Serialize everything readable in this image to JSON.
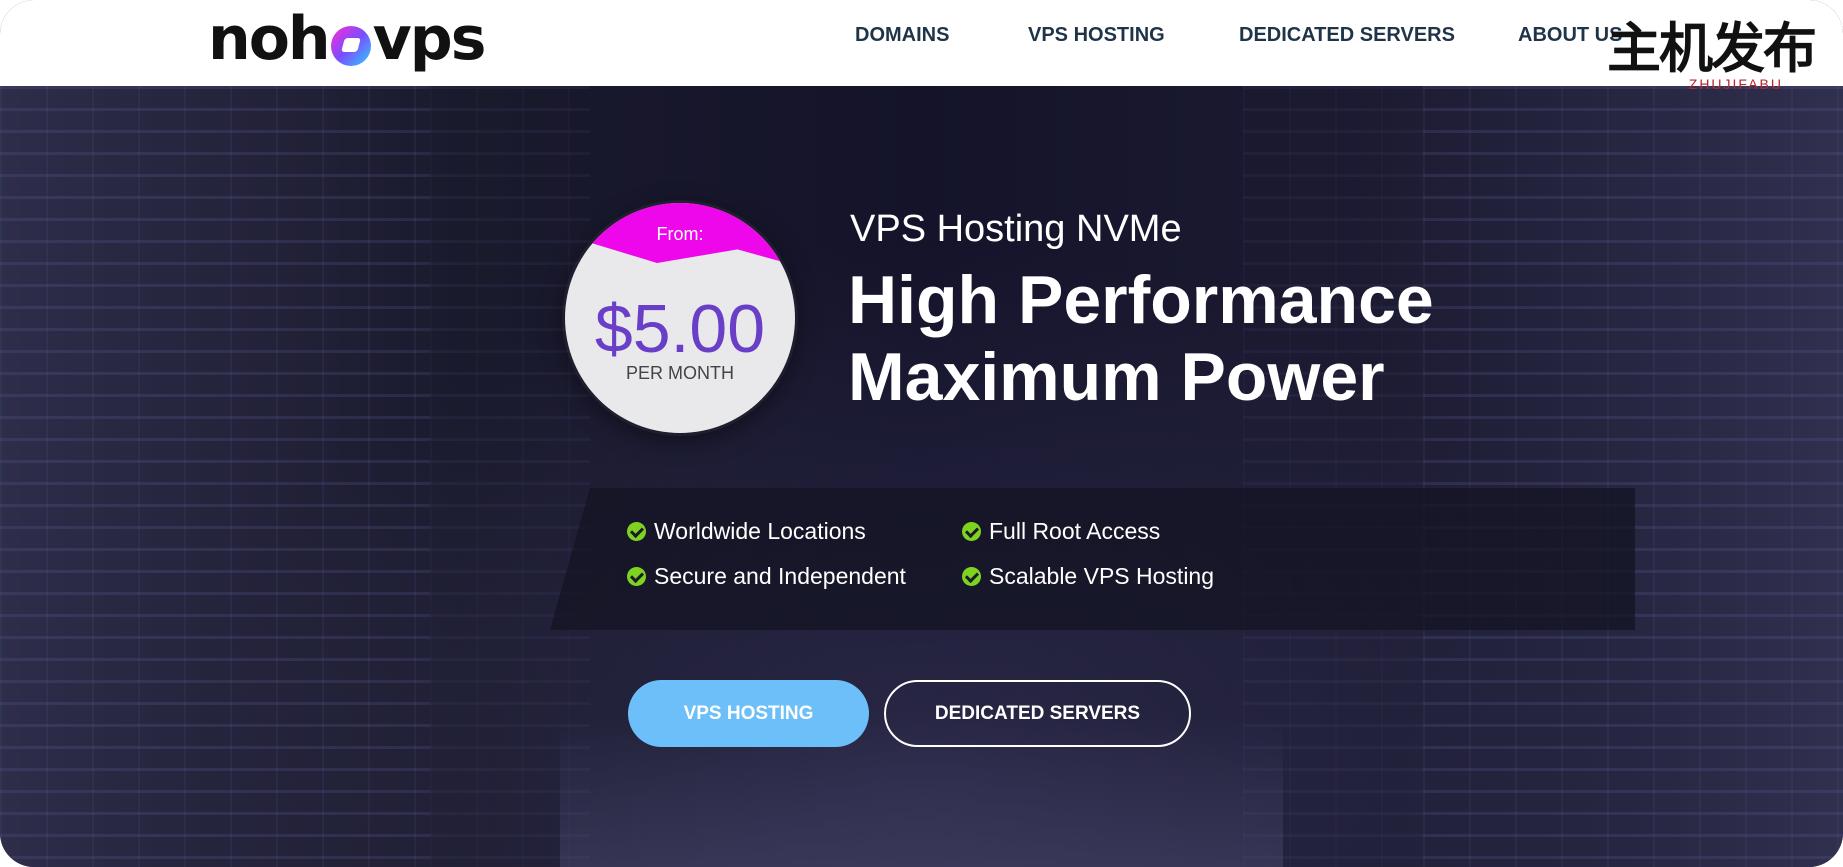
{
  "header": {
    "logo": {
      "left": "noh",
      "right": "vps"
    },
    "nav": [
      {
        "label": "DOMAINS"
      },
      {
        "label": "VPS HOSTING"
      },
      {
        "label": "DEDICATED SERVERS"
      },
      {
        "label": "ABOUT US"
      }
    ]
  },
  "watermark": {
    "text": "主机发布",
    "sub": "ZHUJIFABU"
  },
  "pricing": {
    "from": "From:",
    "price": "$5.00",
    "period": "PER MONTH",
    "colors": {
      "badge": "#ee07ea",
      "price": "#6a3fc8"
    }
  },
  "hero": {
    "subtitle": "VPS Hosting NVMe",
    "headline_line1": "High Performance",
    "headline_line2": "Maximum Power"
  },
  "features": [
    {
      "label": "Worldwide Locations",
      "icon": "check-circle-icon"
    },
    {
      "label": "Full Root Access",
      "icon": "check-circle-icon"
    },
    {
      "label": "Secure and Independent",
      "icon": "check-circle-icon"
    },
    {
      "label": "Scalable VPS Hosting",
      "icon": "check-circle-icon"
    }
  ],
  "buttons": {
    "vps_label": "VPS HOSTING",
    "dedicated_label": "DEDICATED SERVERS",
    "colors": {
      "primary": "#6cbff8"
    }
  }
}
